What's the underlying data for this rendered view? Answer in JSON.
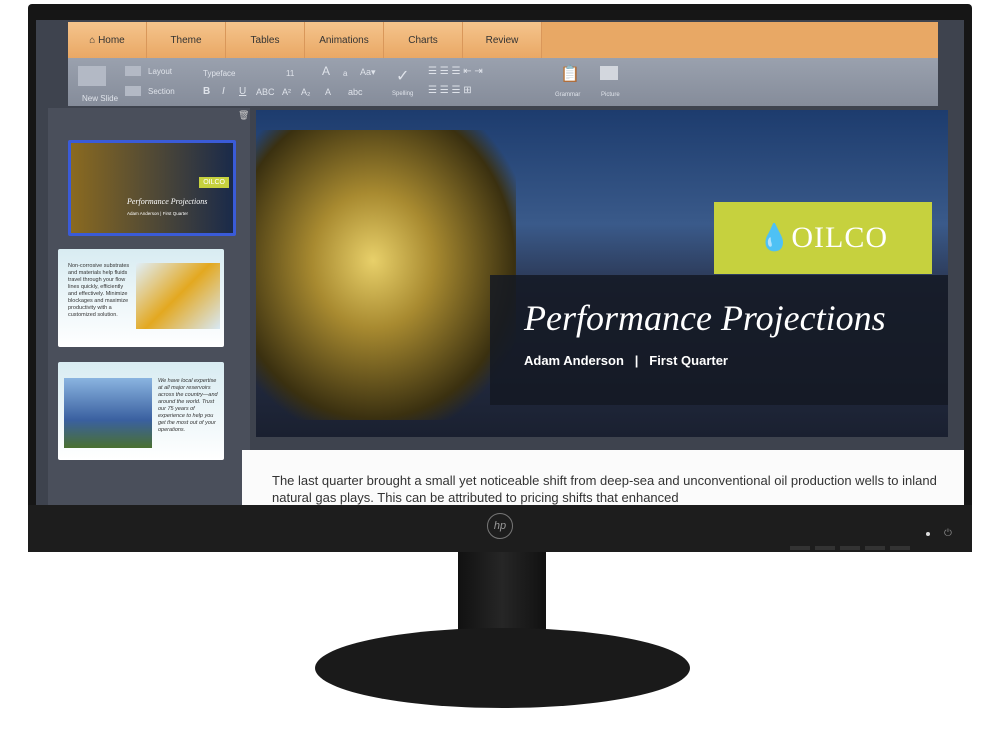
{
  "brand": "hp",
  "tabs": [
    "Home",
    "Theme",
    "Tables",
    "Animations",
    "Charts",
    "Review"
  ],
  "toolbar": {
    "new_slide": "New Slide",
    "layout": "Layout",
    "section": "Section",
    "typeface": "Typeface",
    "font_size": "11",
    "bold": "B",
    "italic": "I",
    "underline": "U",
    "strike": "ABC",
    "superscript": "A²",
    "subscript": "A₂",
    "grow": "A",
    "shrink": "a",
    "case": "Aa▾",
    "highlight": "A",
    "abc": "abc",
    "spelling": "Spelling",
    "grammar": "Grammar",
    "picture": "Picture"
  },
  "thumbnails": [
    {
      "title": "Performance Projections",
      "logo": "OILCO",
      "sub": "Adam Anderson | First Quarter"
    },
    {
      "text": "Non-corrosive substrates and materials help fluids travel through your flow lines quickly, efficiently and effectively. Minimize blockages and maximize productivity with a customized solution."
    },
    {
      "text": "We have local expertise at all major reservoirs across the country—and around the world. Trust our 75 years of experience to help you get the most out of your operations."
    }
  ],
  "slide": {
    "logo": "OILCO",
    "title": "Performance Projections",
    "presenter": "Adam Anderson",
    "separator": "|",
    "period": "First Quarter"
  },
  "notes": "The last quarter brought a small yet noticeable shift from deep-sea and unconventional oil production wells to inland natural gas plays. This can be attributed to pricing shifts that enhanced",
  "colors": {
    "tab_bar": "#e9a865",
    "logo_bg": "#c6d13e",
    "selected_thumb": "#3a5bd8"
  }
}
